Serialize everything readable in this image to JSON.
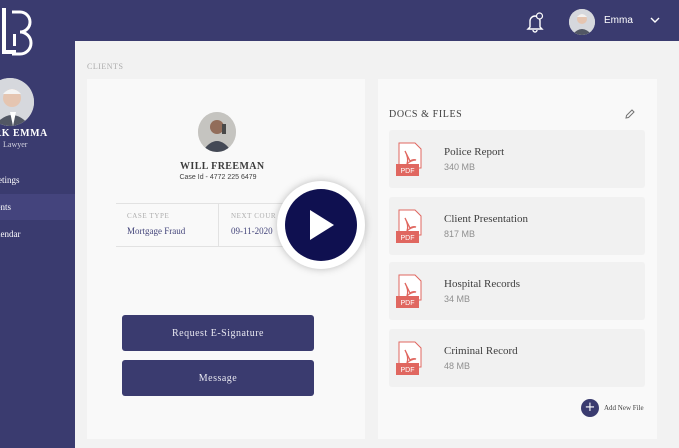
{
  "brand": {
    "logo_letters": "LB"
  },
  "sidebar": {
    "user_name": "RK EMMA",
    "user_role": "Lawyer",
    "items": [
      {
        "label": "eetings",
        "active": false
      },
      {
        "label": "ients",
        "active": true
      },
      {
        "label": "alendar",
        "active": false
      }
    ]
  },
  "topbar": {
    "user_name": "Emma",
    "icons": [
      "bell-icon",
      "chevron-down-icon"
    ]
  },
  "breadcrumb": "CLIENTS",
  "client": {
    "name": "WILL FREEMAN",
    "case_id": "Case Id - 4772 225 6479",
    "case_type_label": "CASE TYPE",
    "case_type_value": "Mortgage Fraud",
    "next_court_label": "NEXT COUR",
    "next_court_value": "09-11-2020"
  },
  "actions": {
    "signature_label": "Request E-Signature",
    "message_label": "Message"
  },
  "files": {
    "title": "DOCS & FILES",
    "badge": "PDF",
    "items": [
      {
        "name": "Police Report",
        "size": "340 MB"
      },
      {
        "name": "Client Presentation",
        "size": "817 MB"
      },
      {
        "name": "Hospital Records",
        "size": "34 MB"
      },
      {
        "name": "Criminal Record",
        "size": "48 MB"
      }
    ],
    "add_label": "Add New File",
    "add_symbol": "+"
  },
  "colors": {
    "navy": "#0f1050",
    "pdf_red": "#d9463d"
  }
}
